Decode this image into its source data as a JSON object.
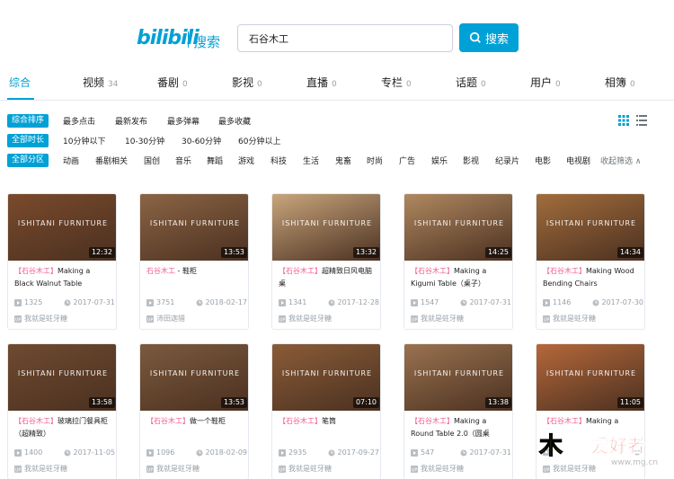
{
  "header": {
    "logo": "bilibili",
    "logo_sub": "搜索",
    "search_value": "石谷木工",
    "search_button": "搜索"
  },
  "tabs": [
    {
      "label": "综合",
      "count": ""
    },
    {
      "label": "视频",
      "count": "34"
    },
    {
      "label": "番剧",
      "count": "0"
    },
    {
      "label": "影视",
      "count": "0"
    },
    {
      "label": "直播",
      "count": "0"
    },
    {
      "label": "专栏",
      "count": "0"
    },
    {
      "label": "话题",
      "count": "0"
    },
    {
      "label": "用户",
      "count": "0"
    },
    {
      "label": "相簿",
      "count": "0"
    }
  ],
  "filters": {
    "sort": {
      "tag": "综合排序",
      "items": [
        "最多点击",
        "最新发布",
        "最多弹幕",
        "最多收藏"
      ]
    },
    "duration": {
      "tag": "全部时长",
      "items": [
        "10分钟以下",
        "10-30分钟",
        "30-60分钟",
        "60分钟以上"
      ]
    },
    "category": {
      "tag": "全部分区",
      "items": [
        "动画",
        "番剧相关",
        "国创",
        "音乐",
        "舞蹈",
        "游戏",
        "科技",
        "生活",
        "鬼畜",
        "时尚",
        "广告",
        "娱乐",
        "影视",
        "纪录片",
        "电影",
        "电视剧"
      ],
      "collapse": "收起筛选 ∧"
    }
  },
  "videos": [
    {
      "brand": "ISHITANI FURNITURE",
      "duration": "12:32",
      "highlight": "【石谷木工】",
      "title": "Making a Black Walnut Table",
      "plays": "1325",
      "date": "2017-07-31",
      "uploader": "我就是蛀牙糖",
      "bg": "#7a4a2c"
    },
    {
      "brand": "ISHITANI FURNITURE",
      "duration": "13:53",
      "highlight": "石谷木工",
      "title": " - 鞋柜",
      "plays": "3751",
      "date": "2018-02-17",
      "uploader": "沛田迦猎",
      "bg": "#8b6444"
    },
    {
      "brand": "ISHITANI FURNITURE",
      "duration": "13:32",
      "highlight": "【石谷木工】",
      "title": "超精致日风电脑桌",
      "plays": "1341",
      "date": "2017-12-28",
      "uploader": "我就是蛀牙糖",
      "bg": "#c8a57c"
    },
    {
      "brand": "ISHITANI FURNITURE",
      "duration": "14:25",
      "highlight": "【石谷木工】",
      "title": "Making a Kigumi Table（桌子）",
      "plays": "1547",
      "date": "2017-07-31",
      "uploader": "我就是蛀牙糖",
      "bg": "#b08860"
    },
    {
      "brand": "ISHITANI FURNITURE",
      "duration": "14:34",
      "highlight": "【石谷木工】",
      "title": "Making Wood Bending Chairs",
      "plays": "1146",
      "date": "2017-07-30",
      "uploader": "我就是蛀牙糖",
      "bg": "#a26d3c"
    },
    {
      "brand": "ISHITANI FURNITURE",
      "duration": "13:58",
      "highlight": "【石谷木工】",
      "title": "玻璃拉门餐具柜（超精致）",
      "plays": "1400",
      "date": "2017-11-05",
      "uploader": "我就是蛀牙糖",
      "bg": "#6f4a30"
    },
    {
      "brand": "ISHITANI FURNITURE",
      "duration": "13:53",
      "highlight": "【石谷木工】",
      "title": "做一个鞋柜",
      "plays": "1096",
      "date": "2018-02-09",
      "uploader": "我就是蛀牙糖",
      "bg": "#7c5a3e"
    },
    {
      "brand": "ISHITANI FURNITURE",
      "duration": "07:10",
      "highlight": "【石谷木工】",
      "title": "笔筒",
      "plays": "2935",
      "date": "2017-09-27",
      "uploader": "我就是蛀牙糖",
      "bg": "#8a5c38"
    },
    {
      "brand": "ISHITANI FURNITURE",
      "duration": "13:38",
      "highlight": "【石谷木工】",
      "title": "Making a Round Table 2.0（圆桌",
      "plays": "547",
      "date": "2017-07-31",
      "uploader": "我就是蛀牙糖",
      "bg": "#9a7250"
    },
    {
      "brand": "ISHITANI FURNITURE",
      "duration": "11:05",
      "highlight": "【石谷木工】",
      "title": "Making a",
      "plays": "",
      "date": "",
      "uploader": "我就是蛀牙糖",
      "bg": "#b5683a"
    }
  ],
  "watermark": {
    "logo": "木",
    "text": "爱好者",
    "sub": "www.mg.cn"
  }
}
